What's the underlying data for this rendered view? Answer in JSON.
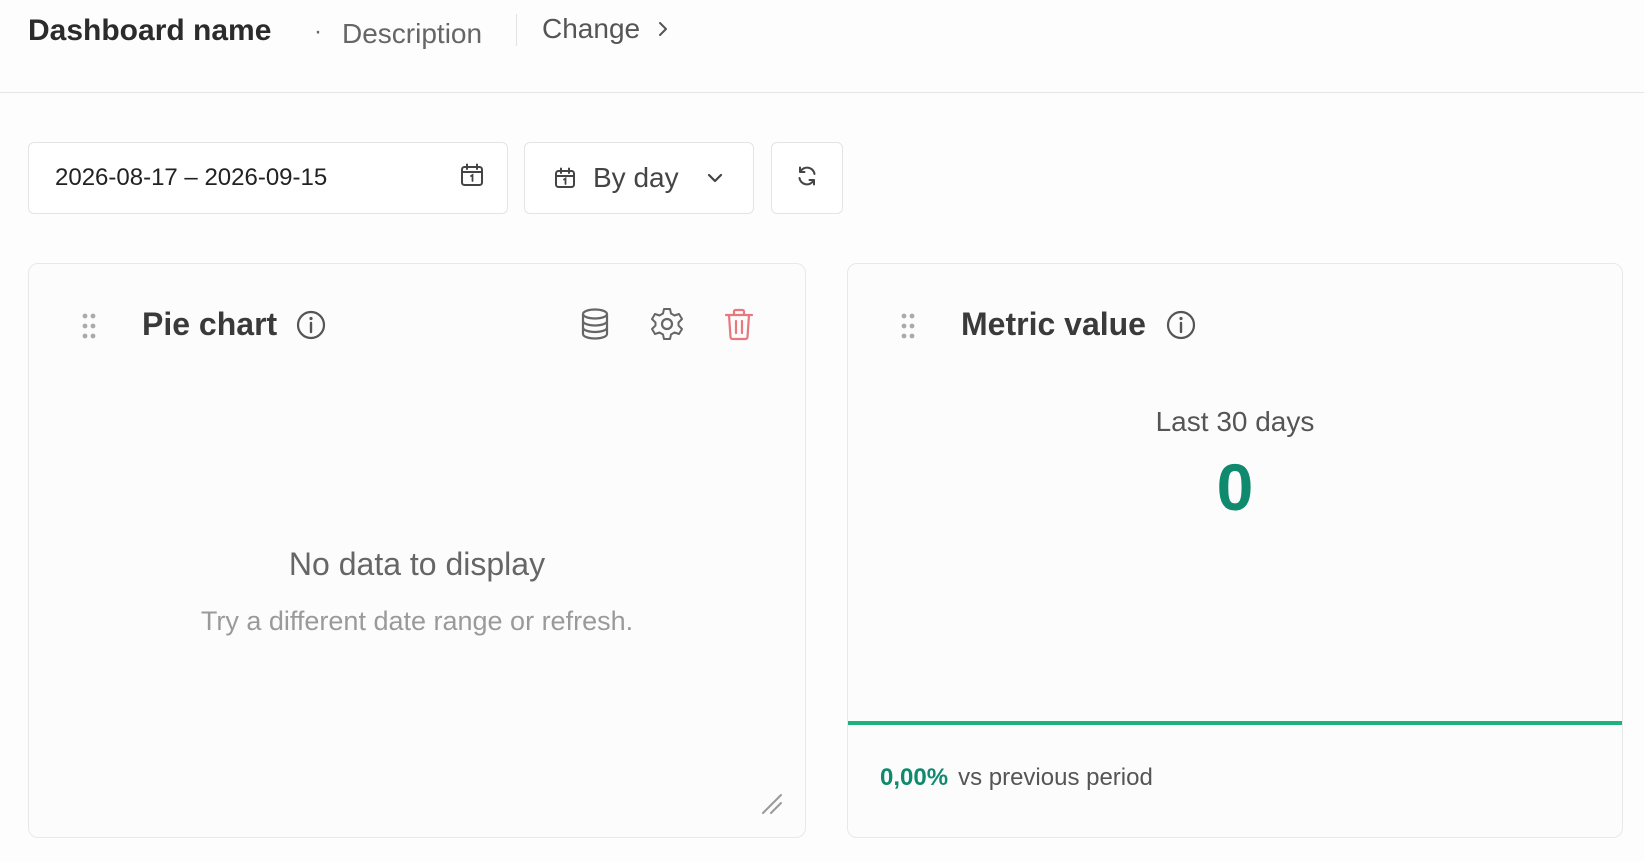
{
  "header": {
    "title": "Dashboard name",
    "separator": "·",
    "description": "Description",
    "change_label": "Change"
  },
  "toolbar": {
    "date_range": "2026-08-17 – 2026-09-15",
    "interval_label": "By day",
    "icons": {
      "date_picker": "calendar-icon",
      "interval": "calendar-icon",
      "interval_dropdown": "chevron-down-icon",
      "refresh": "refresh-icon"
    }
  },
  "pie_card": {
    "title": "Pie chart",
    "empty_title": "No data to display",
    "empty_subtitle": "Try a different date range or refresh.",
    "icons": [
      "drag-handle-icon",
      "info-icon",
      "database-icon",
      "gear-icon",
      "trash-icon",
      "resize-handle-icon"
    ]
  },
  "metric_card": {
    "title": "Metric value",
    "period": "Last 30 days",
    "value": "0",
    "change_pct": "0,00%",
    "change_label": "vs previous period",
    "icons": [
      "drag-handle-icon",
      "info-icon"
    ]
  },
  "colors": {
    "accent_green": "#108a6e",
    "trend_line": "#1fb07f",
    "delete_red": "#e8777e"
  }
}
